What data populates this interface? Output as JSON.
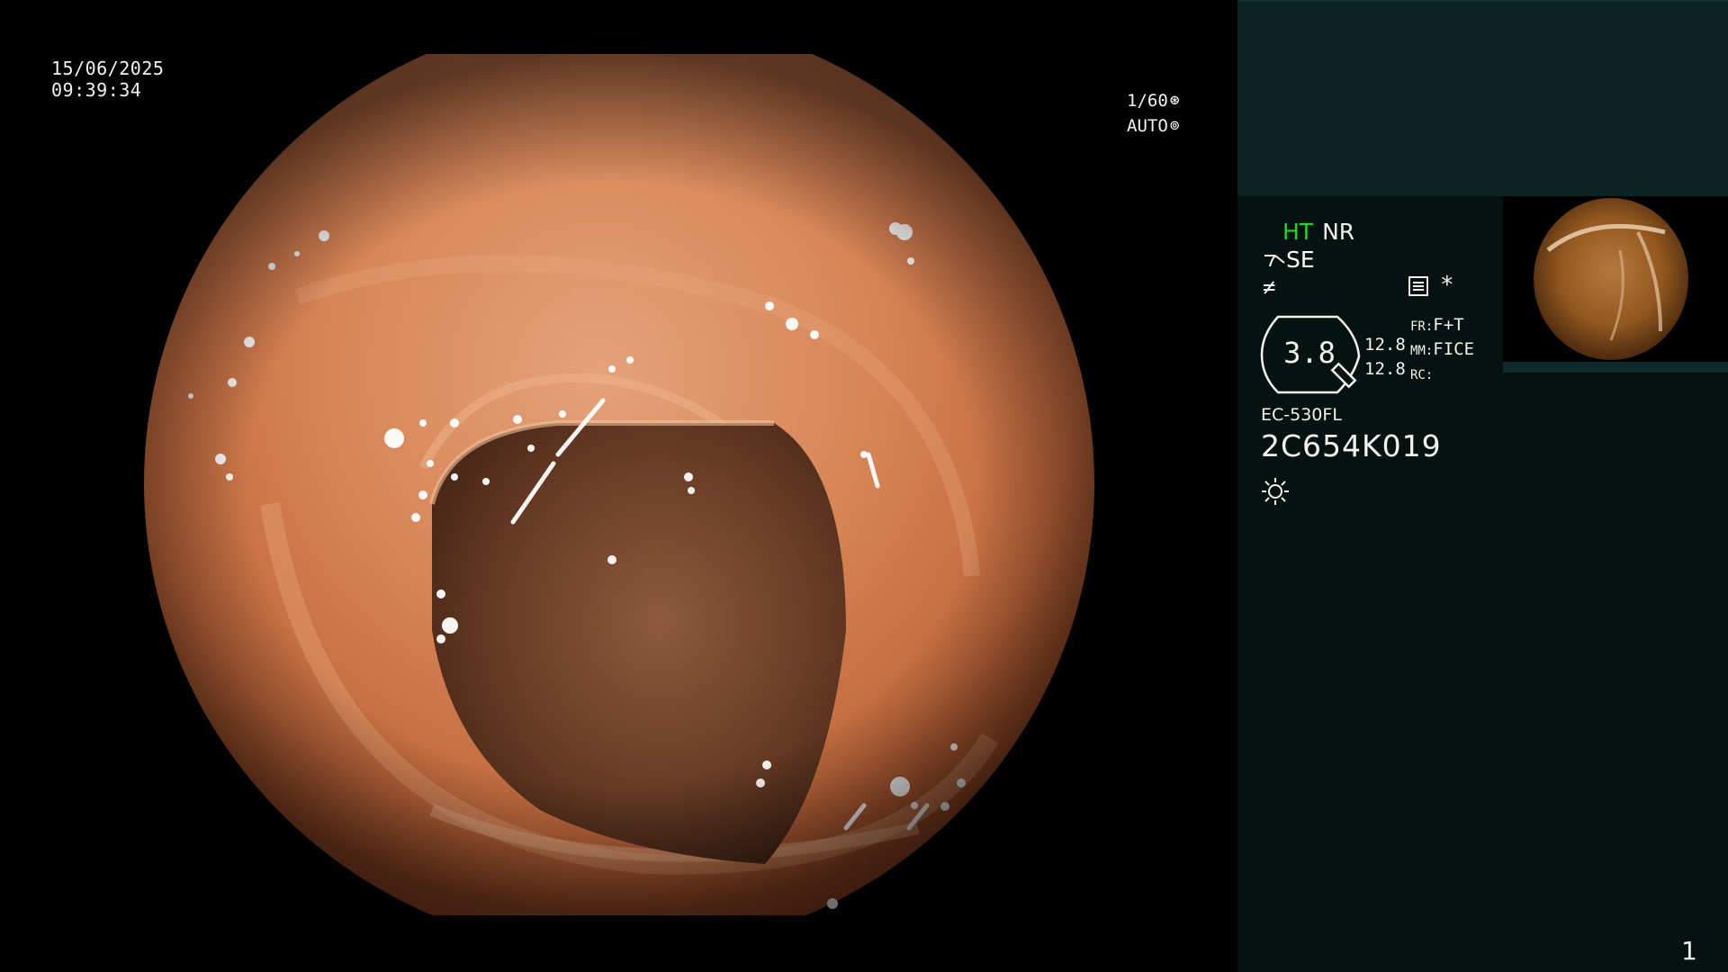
{
  "overlay": {
    "date": "15/06/2025",
    "time": "09:39:34",
    "shutter_speed": "1/60",
    "shutter_icon": "aperture-icon",
    "exposure_mode": "AUTO",
    "exposure_icon": "iris-icon"
  },
  "side_panel": {
    "mode_ht": "HT",
    "mode_nr": "NR",
    "se_label": "SE",
    "zoom": "3.8",
    "value_1": "12.8",
    "value_2": "12.8",
    "fr_key": "FR:",
    "fr_value": "F+T",
    "mm_key": "MM:",
    "mm_value": "FICE",
    "rc_key": "RC:",
    "rc_value": "",
    "scope_model": "EC-530FL",
    "scope_serial": "2C654K019",
    "page_number": "1",
    "colors": {
      "panel_bg": "#051210",
      "panel_top_bg": "#0c2223",
      "ht_color": "#23d623"
    }
  }
}
